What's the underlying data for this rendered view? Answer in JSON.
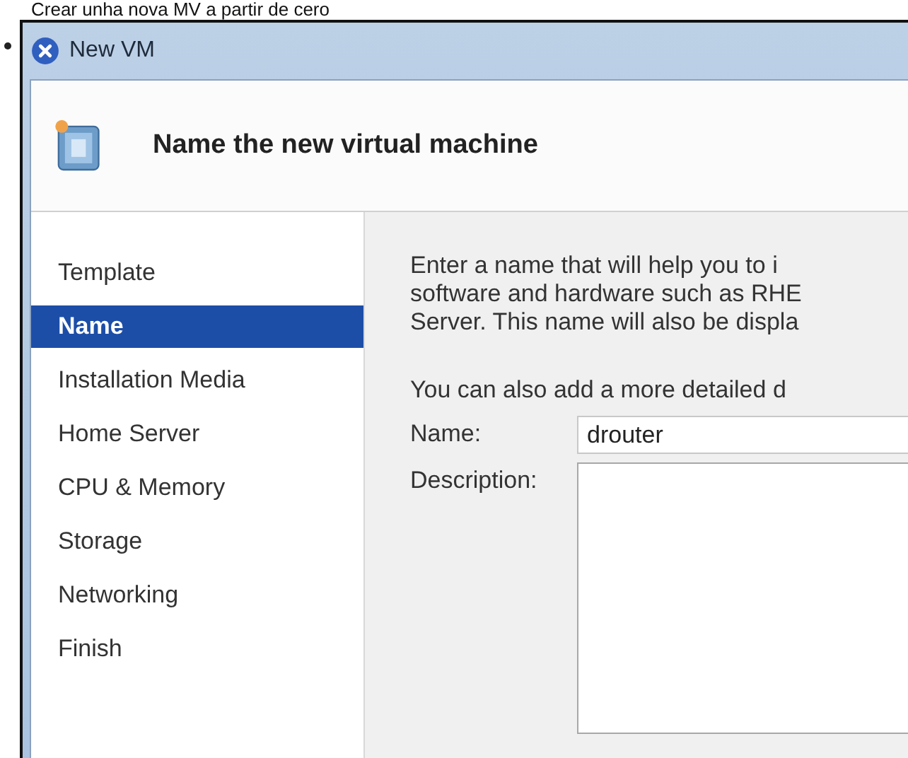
{
  "caption": "Crear unha nova MV a partir de cero",
  "window": {
    "title": "New VM"
  },
  "header": {
    "title": "Name the new virtual machine"
  },
  "steps": [
    {
      "label": "Template",
      "selected": false
    },
    {
      "label": "Name",
      "selected": true
    },
    {
      "label": "Installation Media",
      "selected": false
    },
    {
      "label": "Home Server",
      "selected": false
    },
    {
      "label": "CPU & Memory",
      "selected": false
    },
    {
      "label": "Storage",
      "selected": false
    },
    {
      "label": "Networking",
      "selected": false
    },
    {
      "label": "Finish",
      "selected": false
    }
  ],
  "intro": [
    "Enter a name that will help you to i",
    "software and hardware such as RHE",
    "Server. This name will also be displa"
  ],
  "hint": "You can also add a more detailed d",
  "fields": [
    {
      "label": "Name:",
      "value": "drouter",
      "kind": "input"
    },
    {
      "label": "Description:",
      "kind": "textarea"
    }
  ]
}
